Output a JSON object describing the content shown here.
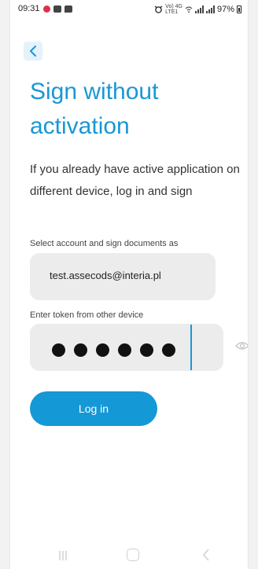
{
  "statusbar": {
    "time": "09:31",
    "network_top": "Vo) 4G",
    "network_bottom": "LTE1",
    "battery": "97%"
  },
  "back_icon": "chevron-left-icon",
  "title": "Sign without activation",
  "intro": "If you already have active application on different device, log in and sign",
  "account": {
    "label": "Select account and sign documents as",
    "value": "test.assecods@interia.pl"
  },
  "token": {
    "label": "Enter token from other device",
    "masked_length": 6,
    "visibility_icon": "eye-icon"
  },
  "login_button": "Log in",
  "colors": {
    "accent": "#1598d6",
    "back_bg": "#e4f3fb",
    "field_bg": "#ececec"
  },
  "navbar": {
    "recents": "recents-icon",
    "home": "home-icon",
    "back": "back-icon"
  }
}
